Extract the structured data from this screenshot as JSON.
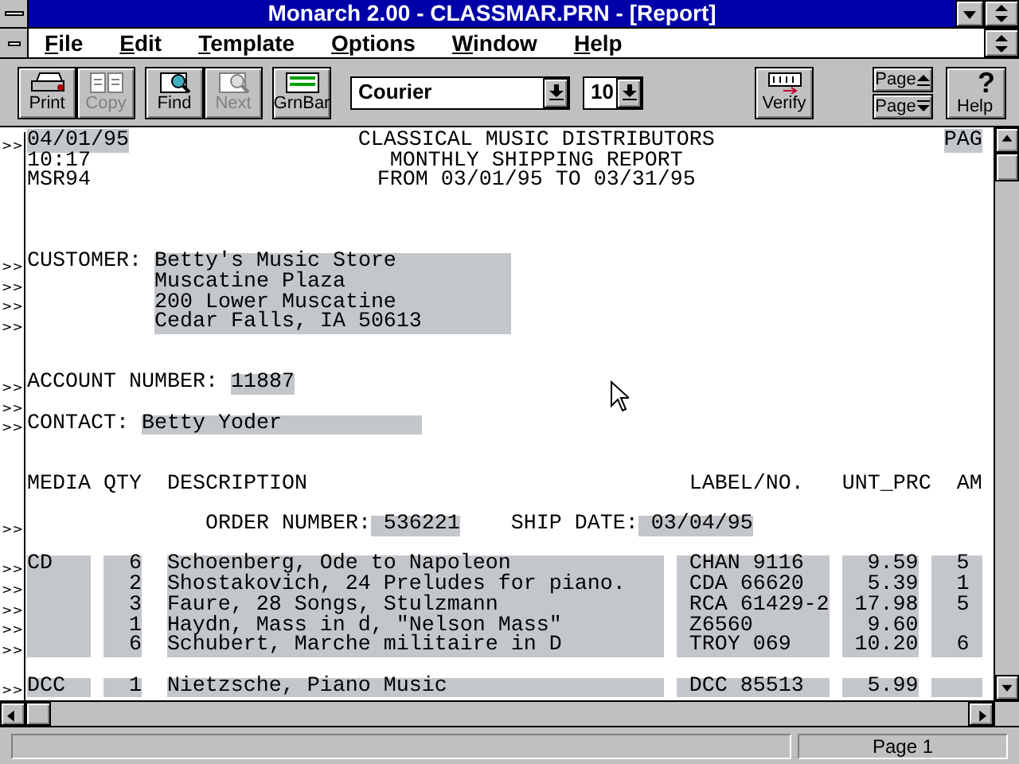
{
  "window": {
    "title": "Monarch 2.00 - CLASSMAR.PRN - [Report]"
  },
  "menu": [
    "File",
    "Edit",
    "Template",
    "Options",
    "Window",
    "Help"
  ],
  "toolbar": [
    {
      "kind": "print",
      "label": "Print",
      "disabled": false
    },
    {
      "kind": "copy",
      "label": "Copy",
      "disabled": true
    },
    {
      "kind": "find",
      "label": "Find",
      "disabled": false
    },
    {
      "kind": "next",
      "label": "Next",
      "disabled": true
    },
    {
      "kind": "grnbar",
      "label": "GrnBar",
      "disabled": false
    }
  ],
  "font_select": {
    "value": "Courier"
  },
  "size_select": {
    "value": "10"
  },
  "verify_button": {
    "label": "Verify"
  },
  "page_buttons": [
    {
      "label": "Page",
      "kind": "up"
    },
    {
      "label": "Page",
      "kind": "down"
    }
  ],
  "help_button": {
    "label": "Help",
    "glyph": "?"
  },
  "report": [
    {
      "kind": "header",
      "marker": ">>",
      "left": "04/01/95",
      "left_highlighted": true,
      "center": "CLASSICAL MUSIC DISTRIBUTORS",
      "right": "PAG"
    },
    {
      "kind": "header",
      "left": "10:17",
      "left_highlighted": false,
      "center": "MONTHLY SHIPPING REPORT"
    },
    {
      "kind": "header",
      "left": "MSR94",
      "left_highlighted": false,
      "center": "FROM 03/01/95 TO 03/31/95"
    },
    {
      "kind": "blank"
    },
    {
      "kind": "blank"
    },
    {
      "kind": "blank"
    },
    {
      "kind": "customer",
      "marker": ">>",
      "label": "CUSTOMER:",
      "value": "Betty's Music Store"
    },
    {
      "kind": "customer",
      "marker": ">>",
      "value": "Muscatine Plaza"
    },
    {
      "kind": "customer",
      "marker": ">>",
      "value": "200 Lower Muscatine"
    },
    {
      "kind": "customer",
      "marker": ">>",
      "value": "Cedar Falls, IA 50613"
    },
    {
      "kind": "blank"
    },
    {
      "kind": "blank"
    },
    {
      "kind": "account",
      "marker": ">>",
      "label": "ACCOUNT NUMBER:",
      "value": "11887"
    },
    {
      "kind": "blank",
      "marker": ">>"
    },
    {
      "kind": "contact",
      "marker": ">>",
      "label": "CONTACT:",
      "value": "Betty Yoder"
    },
    {
      "kind": "blank"
    },
    {
      "kind": "blank"
    },
    {
      "kind": "columns",
      "columns": [
        "MEDIA",
        "QTY",
        "DESCRIPTION",
        "LABEL/NO.",
        "UNT_PRC",
        "AM"
      ]
    },
    {
      "kind": "blank"
    },
    {
      "kind": "order",
      "marker": ">>",
      "order_label": "ORDER NUMBER:",
      "order_number": "536221",
      "date_label": "SHIP DATE:",
      "ship_date": "03/04/95"
    },
    {
      "kind": "blank"
    },
    {
      "kind": "item",
      "marker": ">>",
      "media": "CD",
      "qty": "6",
      "description": "Schoenberg, Ode to Napoleon",
      "label_no": "CHAN 9116",
      "unit_price": "9.59",
      "amount": "5"
    },
    {
      "kind": "item",
      "marker": ">>",
      "qty": "2",
      "description": "Shostakovich, 24 Preludes for piano.",
      "label_no": "CDA 66620",
      "unit_price": "5.39",
      "amount": "1"
    },
    {
      "kind": "item",
      "marker": ">>",
      "qty": "3",
      "description": "Faure, 28 Songs, Stulzmann",
      "label_no": "RCA 61429-2",
      "unit_price": "17.98",
      "amount": "5"
    },
    {
      "kind": "item",
      "marker": ">>",
      "qty": "1",
      "description": "Haydn, Mass in d, \"Nelson Mass\"",
      "label_no": "Z6560",
      "unit_price": "9.60"
    },
    {
      "kind": "item",
      "marker": ">>",
      "qty": "6",
      "description": "Schubert, Marche militaire in D",
      "label_no": "TROY 069",
      "unit_price": "10.20",
      "amount": "6"
    },
    {
      "kind": "blank"
    },
    {
      "kind": "item",
      "marker": ">>",
      "media": "DCC",
      "qty": "1",
      "description": "Nietzsche, Piano Music",
      "label_no": "DCC 85513",
      "unit_price": "5.99"
    }
  ],
  "status_bar": {
    "page": "Page 1"
  }
}
